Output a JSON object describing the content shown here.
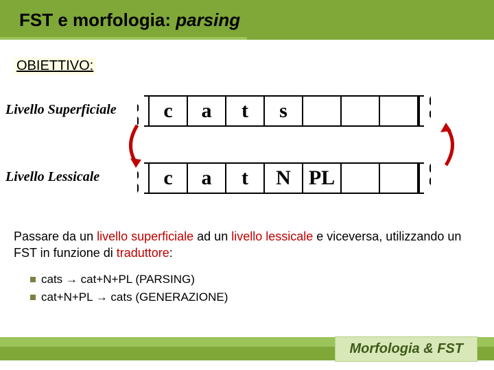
{
  "header": {
    "title_prefix": "FST e morfologia:",
    "title_italic": " parsing"
  },
  "obiettivo": "OBIETTIVO:",
  "levels": {
    "surface": {
      "label": "Livello Superficiale",
      "cells": [
        "c",
        "a",
        "t",
        "s",
        "",
        "",
        ""
      ]
    },
    "lexical": {
      "label": "Livello  Lessicale",
      "cells": [
        "c",
        "a",
        "t",
        "N",
        "PL",
        "",
        ""
      ]
    }
  },
  "paragraph": {
    "p1a": "Passare da un ",
    "p1b": "livello superficiale",
    "p1c": " ad un ",
    "p1d": "livello lessicale",
    "p1e": " e viceversa, utilizzando un FST in funzione di ",
    "p1f": "traduttore",
    "p1g": ":"
  },
  "bullets": {
    "b1a": "cats ",
    "b1b": " cat+N+PL  (PARSING)",
    "b2a": "cat+N+PL ",
    "b2b": " cats  (GENERAZIONE)"
  },
  "footer": {
    "label": "Morfologia & FST"
  }
}
